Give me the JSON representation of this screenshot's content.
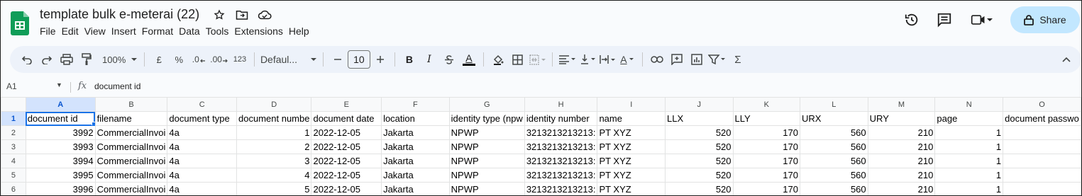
{
  "document": {
    "title": "template bulk e-meterai (22)",
    "menu": [
      "File",
      "Edit",
      "View",
      "Insert",
      "Format",
      "Data",
      "Tools",
      "Extensions",
      "Help"
    ]
  },
  "header": {
    "share_label": "Share"
  },
  "toolbar": {
    "zoom": "100%",
    "currency": "£",
    "percent": "%",
    "dec_decrease": ".0",
    "dec_increase": ".00",
    "number_format": "123",
    "font": "Defaul...",
    "font_size": "10",
    "bold": "B",
    "italic": "I",
    "text_color_letter": "A",
    "halign_letter": "A",
    "function_symbol": "Σ"
  },
  "formula_bar": {
    "cell_ref": "A1",
    "fx": "fx",
    "value": "document id"
  },
  "sheet": {
    "columns": [
      "A",
      "B",
      "C",
      "D",
      "E",
      "F",
      "G",
      "H",
      "I",
      "J",
      "K",
      "L",
      "M",
      "N",
      "O"
    ],
    "header_row": [
      "document id",
      "filename",
      "document type",
      "document numbe",
      "document date",
      "location",
      "identity type (npw",
      "identity number",
      "name",
      "LLX",
      "LLY",
      "URX",
      "URY",
      "page",
      "document passwo"
    ],
    "rows": [
      {
        "n": "2",
        "cells": [
          "3992",
          "CommercialInvoi",
          "4a",
          "1",
          "2022-12-05",
          "Jakarta",
          "NPWP",
          "3213213213213:",
          "PT XYZ",
          "520",
          "170",
          "560",
          "210",
          "1",
          ""
        ]
      },
      {
        "n": "3",
        "cells": [
          "3993",
          "CommercialInvoi",
          "4a",
          "2",
          "2022-12-05",
          "Jakarta",
          "NPWP",
          "3213213213213:",
          "PT XYZ",
          "520",
          "170",
          "560",
          "210",
          "1",
          ""
        ]
      },
      {
        "n": "4",
        "cells": [
          "3994",
          "CommercialInvoi",
          "4a",
          "3",
          "2022-12-05",
          "Jakarta",
          "NPWP",
          "3213213213213:",
          "PT XYZ",
          "520",
          "170",
          "560",
          "210",
          "1",
          ""
        ]
      },
      {
        "n": "5",
        "cells": [
          "3995",
          "CommercialInvoi",
          "4a",
          "4",
          "2022-12-05",
          "Jakarta",
          "NPWP",
          "3213213213213:",
          "PT XYZ",
          "520",
          "170",
          "560",
          "210",
          "1",
          ""
        ]
      },
      {
        "n": "6",
        "cells": [
          "3996",
          "CommercialInvoi",
          "4a",
          "5",
          "2022-12-05",
          "Jakarta",
          "NPWP",
          "3213213213213:",
          "PT XYZ",
          "520",
          "170",
          "560",
          "210",
          "1",
          ""
        ]
      }
    ],
    "row1_label": "1"
  },
  "colors": {
    "selection": "#1a73e8",
    "share_bg": "#c2e7ff",
    "toolbar_bg": "#edf2fa",
    "sheets_green": "#0f9d58"
  }
}
